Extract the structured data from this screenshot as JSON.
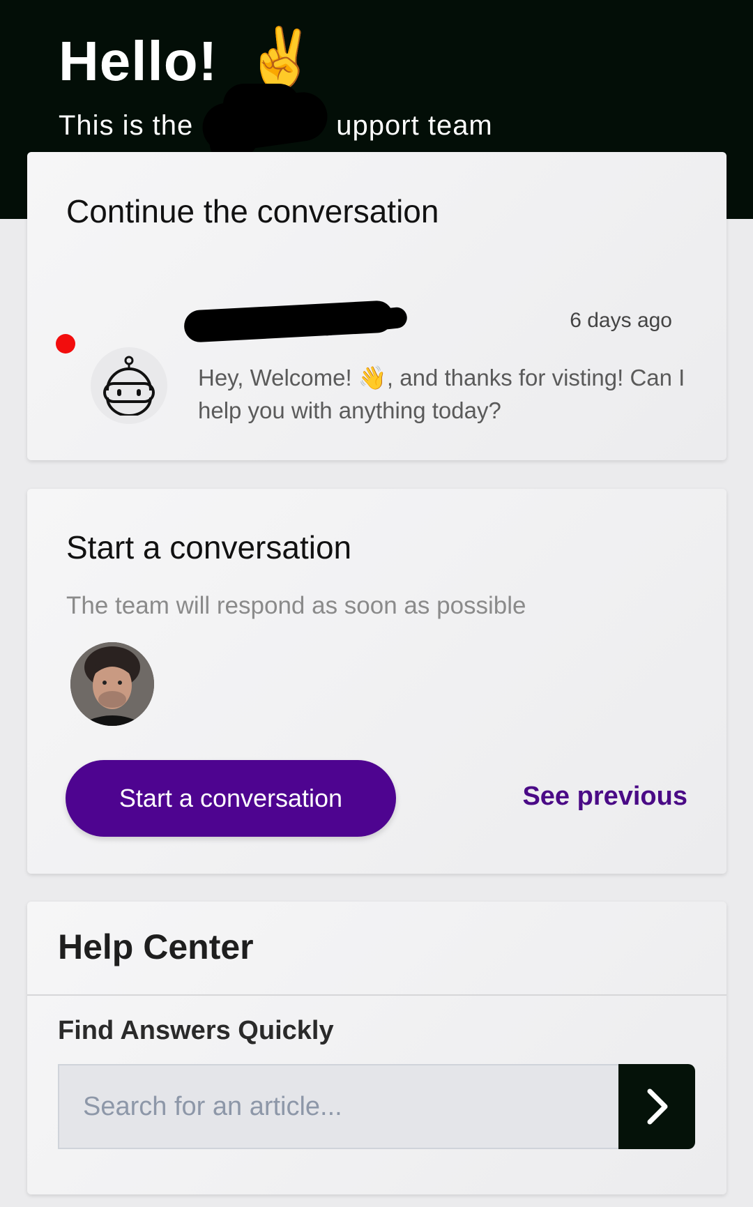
{
  "header": {
    "greeting": "Hello!",
    "greeting_emoji": "✌️",
    "subtitle_start": "This is the",
    "subtitle_end": "upport team"
  },
  "continue_card": {
    "title": "Continue the conversation",
    "time": "6 days ago",
    "message": "Hey, Welcome! 👋, and thanks for visting! Can I help you with anything today?",
    "avatar_icon": "robot-icon",
    "unread_color": "#f20d0d"
  },
  "start_card": {
    "title": "Start a conversation",
    "subtitle": "The team will respond as soon as possible",
    "button_label": "Start a conversation",
    "see_previous": "See previous",
    "accent": "#4e0490"
  },
  "help_center": {
    "title": "Help Center",
    "subtitle": "Find Answers Quickly",
    "search_placeholder": "Search for an article...",
    "search_button_icon": "chevron-right-icon"
  }
}
